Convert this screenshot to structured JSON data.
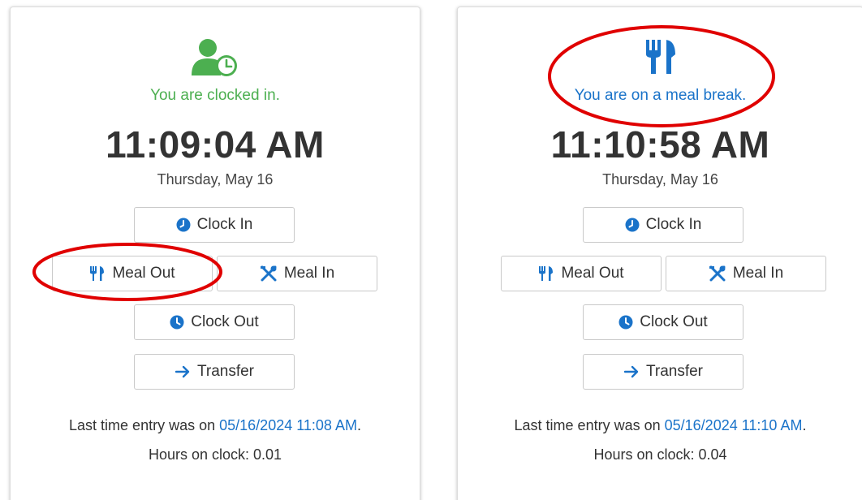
{
  "colors": {
    "accent_blue": "#1a73c9",
    "status_green": "#4caf50",
    "annotation_red": "#e00000"
  },
  "cards": [
    {
      "status_icon": "user-clock-icon",
      "status_text": "You are clocked in.",
      "time": "11:09:04 AM",
      "date": "Thursday, May 16",
      "buttons": {
        "clock_in": "Clock In",
        "meal_out": "Meal Out",
        "meal_in": "Meal In",
        "clock_out": "Clock Out",
        "transfer": "Transfer"
      },
      "last_entry_prefix": "Last time entry was on",
      "last_entry_link": "05/16/2024 11:08 AM",
      "hours_on_clock": "Hours on clock: 0.01"
    },
    {
      "status_icon": "utensils-icon",
      "status_text": "You are on a meal break.",
      "time": "11:10:58 AM",
      "date": "Thursday, May 16",
      "buttons": {
        "clock_in": "Clock In",
        "meal_out": "Meal Out",
        "meal_in": "Meal In",
        "clock_out": "Clock Out",
        "transfer": "Transfer"
      },
      "last_entry_prefix": "Last time entry was on",
      "last_entry_link": "05/16/2024 11:10 AM",
      "hours_on_clock": "Hours on clock: 0.04"
    }
  ]
}
